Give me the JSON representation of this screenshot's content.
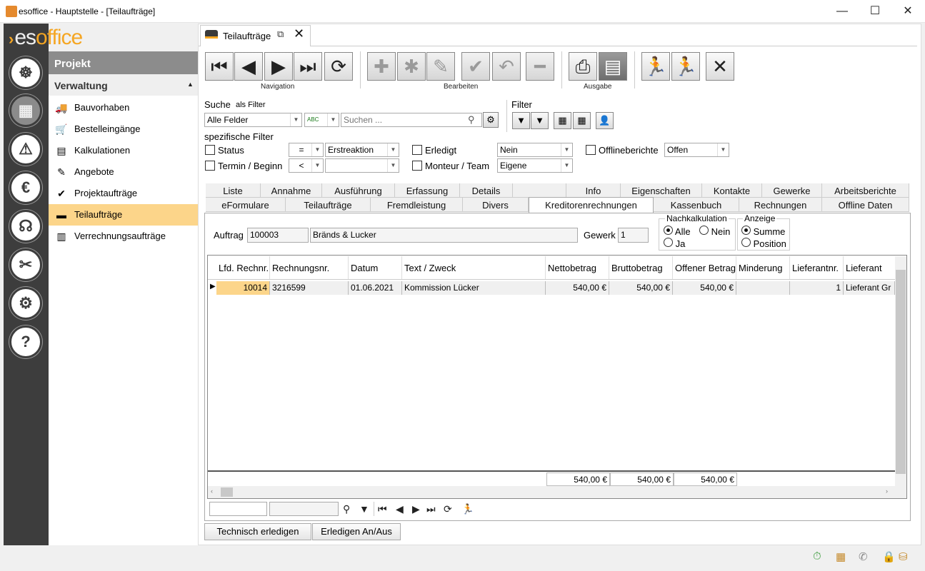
{
  "window": {
    "title": "esoffice - Hauptstelle - [Teilaufträge]",
    "min": "—",
    "max": "☐",
    "close": "✕"
  },
  "logo": {
    "prefix": "es",
    "suffix": "office"
  },
  "left_icons": [
    "helm-icon",
    "project-icon",
    "alarm-icon",
    "finance-icon",
    "support-icon",
    "tools-icon",
    "settings-icon",
    "help-icon"
  ],
  "sidebar": {
    "section": "Projekt",
    "group": "Verwaltung",
    "items": [
      {
        "label": "Bauvorhaben",
        "icon": "truck-icon"
      },
      {
        "label": "Bestelleingänge",
        "icon": "cart-icon"
      },
      {
        "label": "Kalkulationen",
        "icon": "calc-icon"
      },
      {
        "label": "Angebote",
        "icon": "offer-icon"
      },
      {
        "label": "Projektaufträge",
        "icon": "check-circle-icon"
      },
      {
        "label": "Teilaufträge",
        "icon": "folder-icon",
        "active": true
      },
      {
        "label": "Verrechnungsaufträge",
        "icon": "billing-icon"
      }
    ]
  },
  "doc_tab": {
    "label": "Teilaufträge"
  },
  "toolbar": {
    "groups": [
      {
        "label": "Navigation",
        "buttons": [
          "first",
          "prev",
          "next",
          "last",
          "refresh"
        ]
      },
      {
        "label": "Bearbeiten",
        "buttons": [
          "add",
          "new",
          "edit",
          "save",
          "undo",
          "delete"
        ]
      },
      {
        "label": "Ausgabe",
        "buttons": [
          "print",
          "report"
        ]
      }
    ]
  },
  "search": {
    "label": "Suche",
    "as_filter": "als Filter",
    "field": "Alle Felder",
    "placeholder": "Suchen ...",
    "value": "",
    "mode_icon": "ABC"
  },
  "filter": {
    "label": "Filter",
    "specific": "spezifische Filter",
    "rows": {
      "status_label": "Status",
      "status_op": "=",
      "status_value": "Erstreaktion",
      "termin_label": "Termin / Beginn",
      "termin_op": "<",
      "termin_value": "",
      "erledigt_label": "Erledigt",
      "erledigt_value": "Nein",
      "monteur_label": "Monteur / Team",
      "monteur_value": "Eigene",
      "offline_label": "Offlineberichte",
      "offline_value": "Offen"
    }
  },
  "tabs_row1": [
    "Liste",
    "Annahme",
    "Ausführung",
    "Erfassung",
    "Details",
    "",
    "Info",
    "Eigenschaften",
    "Kontakte",
    "Gewerke",
    "Arbeitsberichte"
  ],
  "tabs_row2": [
    "eFormulare",
    "Teilaufträge",
    "Fremdleistung",
    "Divers",
    "Kreditorenrechnungen",
    "Kassenbuch",
    "Rechnungen",
    "Offline Daten"
  ],
  "active_tab": "Kreditorenrechnungen",
  "auftrag": {
    "label": "Auftrag",
    "number": "100003",
    "name": "Bränds & Lucker",
    "gewerk_label": "Gewerk",
    "gewerk": "1"
  },
  "nachkalkulation": {
    "title": "Nachkalkulation",
    "options": [
      "Alle",
      "Nein",
      "Ja"
    ],
    "selected": "Alle"
  },
  "anzeige": {
    "title": "Anzeige",
    "options": [
      "Summe",
      "Position"
    ],
    "selected": "Summe"
  },
  "grid": {
    "columns": [
      "Lfd. Rechnr.",
      "Rechnungsnr.",
      "Datum",
      "Text / Zweck",
      "Nettobetrag",
      "Bruttobetrag",
      "Offener Betrag",
      "Minderung",
      "Lieferantnr.",
      "Lieferant"
    ],
    "rows": [
      {
        "lfd": "10014",
        "rechnungsnr": "3216599",
        "datum": "01.06.2021",
        "text": "Kommission Lücker",
        "netto": "540,00 €",
        "brutto": "540,00 €",
        "offen": "540,00 €",
        "minderung": "",
        "lieferantnr": "1",
        "lieferant": "Lieferant Gr"
      }
    ],
    "totals": {
      "netto": "540,00 €",
      "brutto": "540,00 €",
      "offen": "540,00 €"
    }
  },
  "footer_buttons": {
    "technisch": "Technisch erledigen",
    "erledigen": "Erledigen An/Aus"
  }
}
